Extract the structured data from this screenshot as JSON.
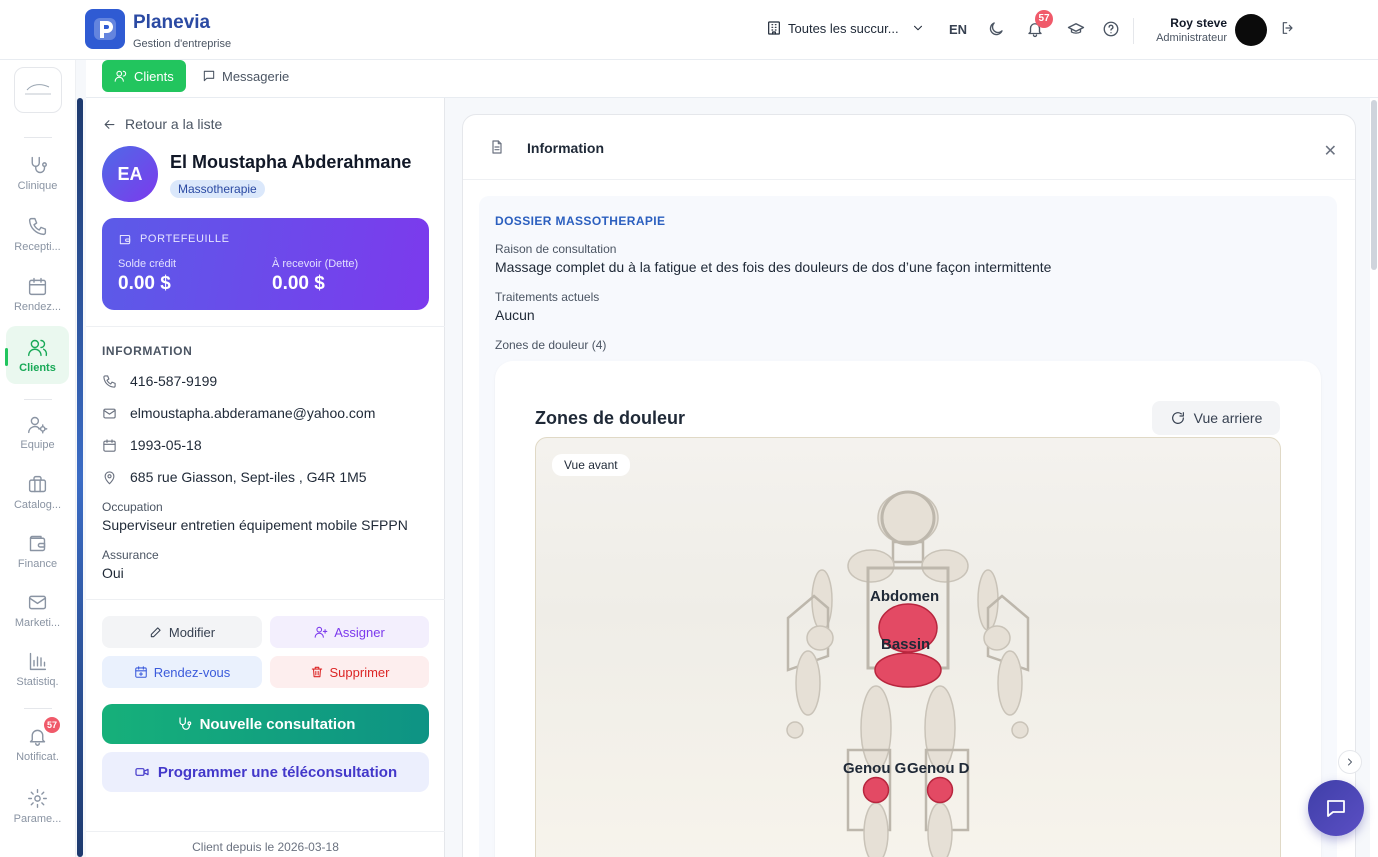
{
  "header": {
    "brand": "Planevia",
    "tagline": "Gestion d'entreprise",
    "branch_selector": "Toutes les succur...",
    "language": "EN",
    "notification_count": "57",
    "user_name": "Roy steve",
    "user_role": "Administrateur"
  },
  "sidebar": {
    "items": [
      {
        "label": "Clinique",
        "icon": "stethoscope-icon"
      },
      {
        "label": "Recepti...",
        "icon": "phone-icon"
      },
      {
        "label": "Rendez...",
        "icon": "calendar-icon"
      },
      {
        "label": "Clients",
        "icon": "users-icon",
        "active": true
      },
      {
        "label": "Equipe",
        "icon": "team-settings-icon"
      },
      {
        "label": "Catalog...",
        "icon": "briefcase-icon"
      },
      {
        "label": "Finance",
        "icon": "wallet-icon"
      },
      {
        "label": "Marketi...",
        "icon": "mail-icon"
      },
      {
        "label": "Statistiq.",
        "icon": "chart-icon"
      },
      {
        "label": "Notificat.",
        "icon": "bell-icon",
        "badge": "57"
      },
      {
        "label": "Parame...",
        "icon": "gear-icon"
      }
    ]
  },
  "subnav": {
    "tabs": [
      {
        "label": "Clients",
        "active": true
      },
      {
        "label": "Messagerie",
        "active": false
      }
    ]
  },
  "client": {
    "back_label": "Retour a la liste",
    "initials": "EA",
    "name": "El Moustapha Abderahmane",
    "tag": "Massotherapie",
    "wallet": {
      "title": "PORTEFEUILLE",
      "credit_label": "Solde crédit",
      "credit_value": "0.00 $",
      "debt_label": "À recevoir (Dette)",
      "debt_value": "0.00 $"
    },
    "info_title": "INFORMATION",
    "phone": "416-587-9199",
    "email": "elmoustapha.abderamane@yahoo.com",
    "birthdate": "1993-05-18",
    "address": "685 rue Giasson, Sept-iles , G4R 1M5",
    "occupation_label": "Occupation",
    "occupation": "Superviseur entretien équipement mobile SFPPN",
    "insurance_label": "Assurance",
    "insurance": "Oui",
    "actions": {
      "edit": "Modifier",
      "assign": "Assigner",
      "appointment": "Rendez-vous",
      "delete": "Supprimer",
      "new_consultation": "Nouvelle consultation",
      "teleconsultation": "Programmer une téléconsultation"
    },
    "client_since": "Client depuis le 2026-03-18"
  },
  "main": {
    "card_title": "Information",
    "dossier_title": "DOSSIER MASSOTHERAPIE",
    "reason_label": "Raison de consultation",
    "reason": "Massage complet du à la fatigue et des fois des douleurs de dos d’une façon intermittente",
    "treatments_label": "Traitements actuels",
    "treatments": "Aucun",
    "pain_zones_label": "Zones de douleur (4)",
    "zones_title": "Zones de douleur",
    "view_back_button": "Vue arriere",
    "view_front_label": "Vue avant",
    "zones": [
      "Abdomen",
      "Bassin",
      "Genou G",
      "Genou D"
    ],
    "highlight_color": "#e34a64"
  },
  "colors": {
    "brand": "#2f5bd3",
    "active_green": "#22c55e",
    "wallet_gradient_start": "#5b5be8",
    "wallet_gradient_end": "#7c3aed",
    "consult_green": "#10b981"
  }
}
